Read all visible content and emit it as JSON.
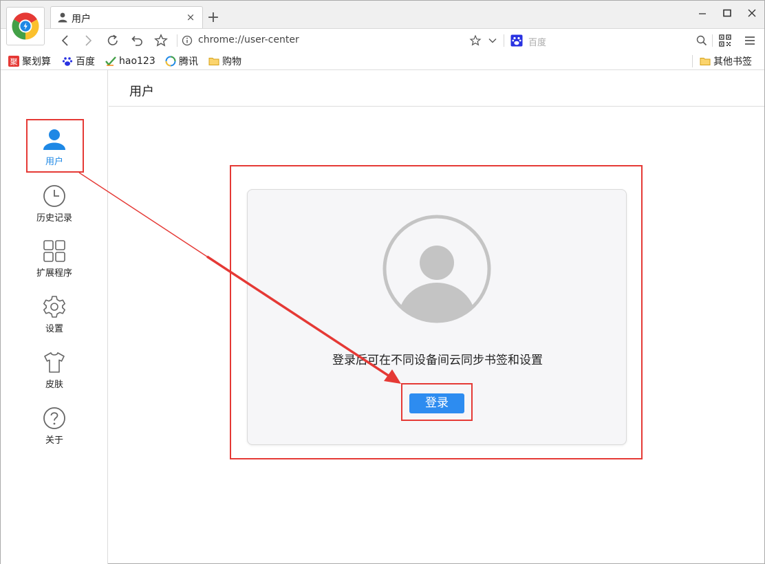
{
  "tab": {
    "title": "用户"
  },
  "toolbar": {
    "url": "chrome://user-center",
    "search_placeholder": "百度"
  },
  "bookmarks": {
    "items": [
      {
        "label": "聚划算",
        "icon": "juhuasuan-icon"
      },
      {
        "label": "百度",
        "icon": "baidu-paw-icon"
      },
      {
        "label": "hao123",
        "icon": "hao123-icon"
      },
      {
        "label": "腾讯",
        "icon": "tencent-icon"
      },
      {
        "label": "购物",
        "icon": "folder-icon"
      }
    ],
    "other": "其他书签"
  },
  "sidebar": {
    "items": [
      {
        "label": "用户",
        "icon": "user-icon",
        "active": true
      },
      {
        "label": "历史记录",
        "icon": "clock-icon"
      },
      {
        "label": "扩展程序",
        "icon": "grid-icon"
      },
      {
        "label": "设置",
        "icon": "gear-icon"
      },
      {
        "label": "皮肤",
        "icon": "shirt-icon"
      },
      {
        "label": "关于",
        "icon": "help-icon"
      }
    ]
  },
  "main": {
    "title": "用户",
    "sync_text": "登录后可在不同设备间云同步书签和设置",
    "login_label": "登录"
  },
  "colors": {
    "accent": "#1e88e5",
    "button": "#2d8cf0",
    "highlight": "#e53935"
  }
}
